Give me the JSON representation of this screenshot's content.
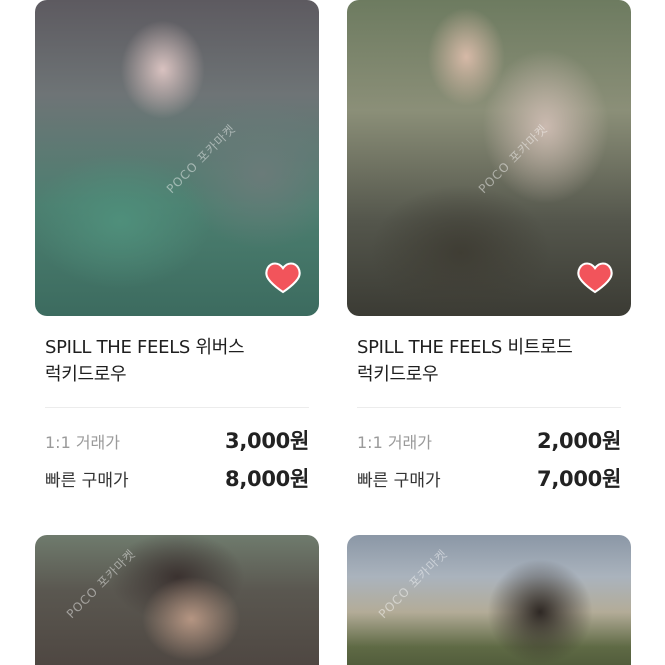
{
  "watermark": "POCO 포카마켓",
  "listings": [
    {
      "title_line1": "SPILL THE FEELS 위버스",
      "title_line2": "럭키드로우",
      "trade_label": "1:1 거래가",
      "trade_price": "3,000원",
      "buy_label": "빠른 구매가",
      "buy_price": "8,000원",
      "liked": true
    },
    {
      "title_line1": "SPILL THE FEELS 비트로드",
      "title_line2": "럭키드로우",
      "trade_label": "1:1 거래가",
      "trade_price": "2,000원",
      "buy_label": "빠른 구매가",
      "buy_price": "7,000원",
      "liked": true
    },
    {
      "liked": false
    },
    {
      "liked": false
    }
  ],
  "colors": {
    "heart": "#f2545b",
    "divider": "#ececec"
  }
}
